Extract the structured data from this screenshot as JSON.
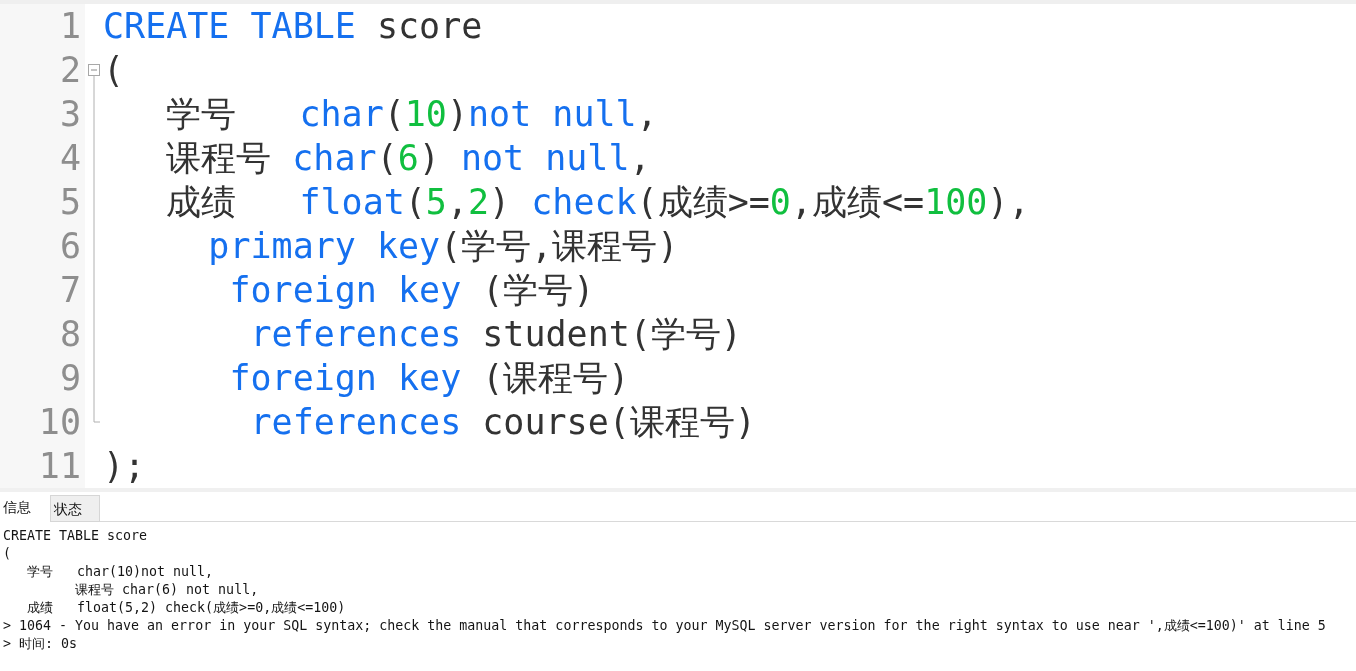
{
  "editor": {
    "fold": {
      "expanded": true
    },
    "lines": [
      {
        "number": "1",
        "tokens": [
          {
            "kind": "keyword",
            "text": "CREATE TABLE"
          },
          {
            "kind": "plain",
            "text": " score"
          }
        ]
      },
      {
        "number": "2",
        "tokens": [
          {
            "kind": "plain",
            "text": "("
          }
        ]
      },
      {
        "number": "3",
        "tokens": [
          {
            "kind": "plain",
            "text": "学号   "
          },
          {
            "kind": "keyword",
            "text": "char"
          },
          {
            "kind": "plain",
            "text": "("
          },
          {
            "kind": "number",
            "text": "10"
          },
          {
            "kind": "plain",
            "text": ")"
          },
          {
            "kind": "keyword",
            "text": "not null"
          },
          {
            "kind": "plain",
            "text": ","
          }
        ]
      },
      {
        "number": "4",
        "tokens": [
          {
            "kind": "plain",
            "text": "课程号 "
          },
          {
            "kind": "keyword",
            "text": "char"
          },
          {
            "kind": "plain",
            "text": "("
          },
          {
            "kind": "number",
            "text": "6"
          },
          {
            "kind": "plain",
            "text": ") "
          },
          {
            "kind": "keyword",
            "text": "not null"
          },
          {
            "kind": "plain",
            "text": ","
          }
        ]
      },
      {
        "number": "5",
        "tokens": [
          {
            "kind": "plain",
            "text": "成绩   "
          },
          {
            "kind": "keyword",
            "text": "float"
          },
          {
            "kind": "plain",
            "text": "("
          },
          {
            "kind": "number",
            "text": "5"
          },
          {
            "kind": "plain",
            "text": ","
          },
          {
            "kind": "number",
            "text": "2"
          },
          {
            "kind": "plain",
            "text": ") "
          },
          {
            "kind": "keyword",
            "text": "check"
          },
          {
            "kind": "plain",
            "text": "(成绩>="
          },
          {
            "kind": "number",
            "text": "0"
          },
          {
            "kind": "plain",
            "text": ",成绩<="
          },
          {
            "kind": "number",
            "text": "100"
          },
          {
            "kind": "plain",
            "text": "),"
          }
        ]
      },
      {
        "number": "6",
        "tokens": [
          {
            "kind": "keyword",
            "text": "primary key"
          },
          {
            "kind": "plain",
            "text": "(学号,课程号)"
          }
        ]
      },
      {
        "number": "7",
        "tokens": [
          {
            "kind": "keyword",
            "text": "foreign key"
          },
          {
            "kind": "plain",
            "text": " (学号)"
          }
        ]
      },
      {
        "number": "8",
        "tokens": [
          {
            "kind": "keyword",
            "text": "references"
          },
          {
            "kind": "plain",
            "text": " student(学号)"
          }
        ]
      },
      {
        "number": "9",
        "tokens": [
          {
            "kind": "keyword",
            "text": "foreign key"
          },
          {
            "kind": "plain",
            "text": " (课程号)"
          }
        ]
      },
      {
        "number": "10",
        "tokens": [
          {
            "kind": "keyword",
            "text": "references"
          },
          {
            "kind": "plain",
            "text": " course(课程号)"
          }
        ]
      },
      {
        "number": "11",
        "tokens": [
          {
            "kind": "plain",
            "text": ");"
          }
        ]
      }
    ]
  },
  "output_panel": {
    "tabs": [
      {
        "label": "信息",
        "selected": true
      },
      {
        "label": "状态",
        "selected": false
      }
    ],
    "log": [
      "CREATE TABLE score",
      "(",
      "学号   char(10)not null,",
      "课程号 char(6) not null,",
      "成绩   float(5,2) check(成绩>=0,成绩<=100)",
      "> 1064 - You have an error in your SQL syntax; check the manual that corresponds to your MySQL server version for the right syntax to use near ',成绩<=100)' at line 5",
      "> 时间: 0s"
    ]
  }
}
